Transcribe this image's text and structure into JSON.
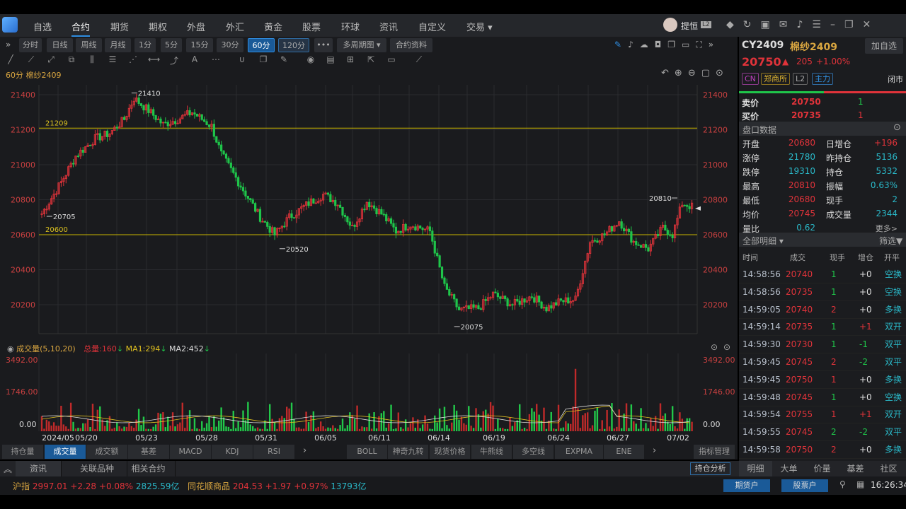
{
  "menu": {
    "items": [
      "自选",
      "合约",
      "期货",
      "期权",
      "外盘",
      "外汇",
      "黄金",
      "股票",
      "环球",
      "资讯",
      "自定义",
      "交易 ▾"
    ],
    "active": 1
  },
  "user": {
    "name": "提恒",
    "level": "L2"
  },
  "periods": [
    "分时",
    "日线",
    "周线",
    "月线",
    "1分",
    "5分",
    "15分",
    "30分",
    "60分",
    "120分",
    "•••",
    "多周期图 ▾",
    "合约资料"
  ],
  "selected_period": "60分",
  "chart_title": "60分 棉纱2409",
  "contract": {
    "code": "CY2409",
    "name": "棉纱2409",
    "price": "20750",
    "change": "205",
    "pct": "+1.00%",
    "tags": [
      "CN",
      "郑商所",
      "L2",
      "主力"
    ],
    "status": "闭市",
    "watch_btn": "加自选"
  },
  "quote": {
    "sell": {
      "label": "卖价",
      "price": "20750",
      "vol": "1"
    },
    "buy": {
      "label": "买价",
      "price": "20735",
      "vol": "1"
    }
  },
  "panel_title": "盘口数据",
  "stats": [
    {
      "l": "开盘",
      "v": "20680",
      "l2": "日增仓",
      "v2": "+196"
    },
    {
      "l": "涨停",
      "v": "21780",
      "l2": "昨持仓",
      "v2": "5136"
    },
    {
      "l": "跌停",
      "v": "19310",
      "l2": "持仓",
      "v2": "5332"
    },
    {
      "l": "最高",
      "v": "20810",
      "l2": "振幅",
      "v2": "0.63%"
    },
    {
      "l": "最低",
      "v": "20680",
      "l2": "现手",
      "v2": "2"
    },
    {
      "l": "均价",
      "v": "20745",
      "l2": "成交量",
      "v2": "2344"
    },
    {
      "l": "量比",
      "v": "0.62",
      "l2": "",
      "v2": "更多>"
    }
  ],
  "detail": {
    "title": "全部明细 ▾",
    "filter": "筛选",
    "headers": [
      "时间",
      "成交",
      "现手",
      "增仓",
      "开平"
    ],
    "rows": [
      [
        "14:58:56",
        "20740",
        "1",
        "+0",
        "空换"
      ],
      [
        "14:58:56",
        "20735",
        "1",
        "+0",
        "空换"
      ],
      [
        "14:59:05",
        "20740",
        "2",
        "+0",
        "多换"
      ],
      [
        "14:59:14",
        "20735",
        "1",
        "+1",
        "双开"
      ],
      [
        "14:59:30",
        "20730",
        "1",
        "-1",
        "双平"
      ],
      [
        "14:59:45",
        "20745",
        "2",
        "-2",
        "双平"
      ],
      [
        "14:59:45",
        "20750",
        "1",
        "+0",
        "多换"
      ],
      [
        "14:59:48",
        "20745",
        "1",
        "+0",
        "空换"
      ],
      [
        "14:59:54",
        "20755",
        "1",
        "+1",
        "双开"
      ],
      [
        "14:59:55",
        "20745",
        "2",
        "-2",
        "双平"
      ],
      [
        "14:59:58",
        "20750",
        "2",
        "+0",
        "多换"
      ]
    ]
  },
  "chart_data": {
    "type": "candlestick",
    "price_ticks": [
      "21400",
      "21200",
      "21000",
      "20800",
      "20600",
      "20400",
      "20200"
    ],
    "ylim": [
      20100,
      21500
    ],
    "lines": [
      {
        "label": "21209",
        "value": 21209
      },
      {
        "label": "20600",
        "value": 20600
      }
    ],
    "annotations": [
      {
        "label": "21410",
        "value": 21410
      },
      {
        "label": "20705",
        "value": 20705
      },
      {
        "label": "20520",
        "value": 20520
      },
      {
        "label": "20075",
        "value": 20075
      },
      {
        "label": "20810",
        "value": 20810
      }
    ],
    "dates": [
      "2024/05",
      "05/20",
      "05/23",
      "05/28",
      "05/31",
      "06/05",
      "06/11",
      "06/14",
      "06/19",
      "06/24",
      "06/27",
      "07/02"
    ],
    "volume": {
      "title": "成交量(5,10,20)",
      "total": "总量:160",
      "ma1": "MA1:294",
      "ma2": "MA2:452",
      "ticks": [
        "3492.00",
        "1746.00",
        "0.00"
      ],
      "ylim": [
        0,
        3492
      ]
    }
  },
  "indicator_tabs": [
    "持仓量",
    "成交量",
    "成交额",
    "基差",
    "MACD",
    "KDJ",
    "RSI"
  ],
  "overlay_tabs": [
    "BOLL",
    "神奇九转",
    "现货价格",
    "牛熊线",
    "多空线",
    "EXPMA",
    "ENE"
  ],
  "indicator_manage": "指标管理",
  "bottom_tabs": [
    "资讯",
    "关联品种",
    "相关合约"
  ],
  "position_analysis": "持仓分析",
  "right_tabs": [
    "明细",
    "大单",
    "价量",
    "基差",
    "社区"
  ],
  "status": {
    "idx1": "沪指",
    "v1": "2997.01",
    "c1": "+2.28",
    "p1": "+0.08%",
    "a1": "2825.59亿",
    "idx2": "同花顺商品",
    "v2": "204.53",
    "c2": "+1.97",
    "p2": "+0.97%",
    "a2": "13793亿",
    "btn1": "期货户",
    "btn2": "股票户",
    "time": "16:26:34"
  },
  "colors": {
    "up": "#e0333a",
    "down": "#1fc54a",
    "accent": "#2f8de0",
    "level_line": "#c8b400"
  }
}
